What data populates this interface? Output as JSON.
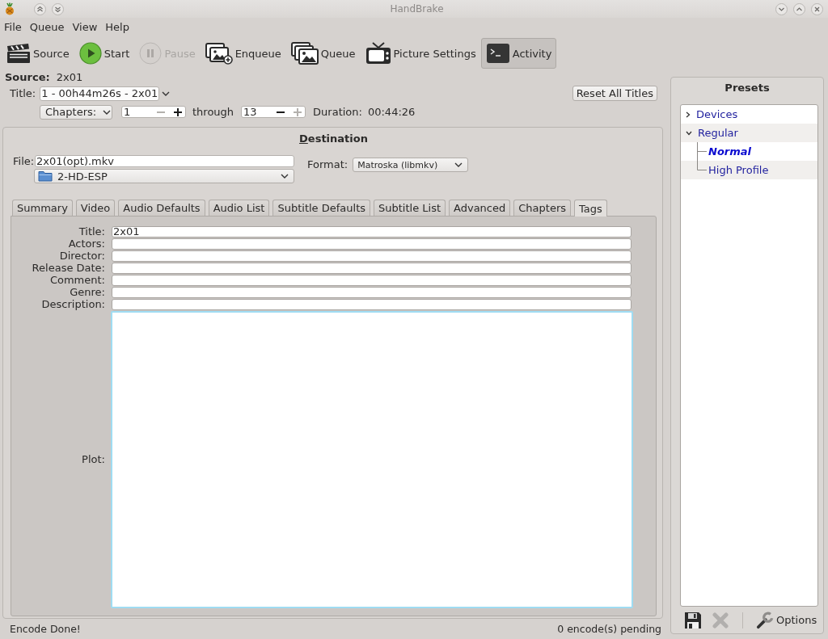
{
  "window": {
    "title": "HandBrake"
  },
  "menu": [
    "File",
    "Queue",
    "View",
    "Help"
  ],
  "toolbar": [
    {
      "label": "Source",
      "kind": "clapperboard",
      "disabled": false,
      "selected": false
    },
    {
      "label": "Start",
      "kind": "play",
      "disabled": false,
      "selected": false
    },
    {
      "label": "Pause",
      "kind": "pause",
      "disabled": true,
      "selected": false
    },
    {
      "label": "Enqueue",
      "kind": "images-add",
      "disabled": false,
      "selected": false
    },
    {
      "label": "Queue",
      "kind": "images",
      "disabled": false,
      "selected": false
    },
    {
      "label": "Picture Settings",
      "kind": "tv",
      "disabled": false,
      "selected": false
    },
    {
      "label": "Activity",
      "kind": "terminal",
      "disabled": false,
      "selected": true
    }
  ],
  "source": {
    "label": "Source:",
    "value": "2x01"
  },
  "title": {
    "label": "Title:",
    "value": "1 - 00h44m26s - 2x01"
  },
  "reset_button": "Reset All Titles",
  "range": {
    "mode": "Chapters:",
    "start": {
      "value": "1",
      "minus_disabled": true,
      "plus_disabled": false
    },
    "through": "through",
    "end": {
      "value": "13",
      "minus_disabled": false,
      "plus_disabled": true
    },
    "duration_label": "Duration:",
    "duration": "00:44:26"
  },
  "destination": {
    "heading": "Destination",
    "file_label": "File:",
    "file": "2x01(opt).mkv",
    "folder": "2-HD-ESP",
    "format_label": "Format:",
    "format": "Matroska (libmkv)"
  },
  "tabs": [
    {
      "label": "Summary",
      "selected": false
    },
    {
      "label": "Video",
      "selected": false
    },
    {
      "label": "Audio Defaults",
      "selected": false
    },
    {
      "label": "Audio List",
      "selected": false
    },
    {
      "label": "Subtitle Defaults",
      "selected": false
    },
    {
      "label": "Subtitle List",
      "selected": false
    },
    {
      "label": "Advanced",
      "selected": false
    },
    {
      "label": "Chapters",
      "selected": false
    },
    {
      "label": "Tags",
      "selected": true
    }
  ],
  "tags": {
    "fields": [
      {
        "label": "Title:",
        "value": "2x01"
      },
      {
        "label": "Actors:"
      },
      {
        "label": "Director:"
      },
      {
        "label": "Release Date:"
      },
      {
        "label": "Comment:"
      },
      {
        "label": "Genre:"
      },
      {
        "label": "Description:"
      }
    ],
    "plot": {
      "label": "Plot:",
      "focused": true
    }
  },
  "status_bar": {
    "message": "Encode Done!",
    "pending": "0 encode(s) pending"
  },
  "presets": {
    "heading": "Presets",
    "tree": [
      {
        "label": "Devices",
        "expanded": false
      },
      {
        "label": "Regular",
        "expanded": true,
        "children": [
          {
            "label": "Normal",
            "default": true
          },
          {
            "label": "High Profile",
            "default": false
          }
        ]
      }
    ],
    "actions": [
      {
        "kind": "save",
        "disabled": false
      },
      {
        "kind": "delete",
        "disabled": true
      }
    ],
    "options": "Options"
  }
}
